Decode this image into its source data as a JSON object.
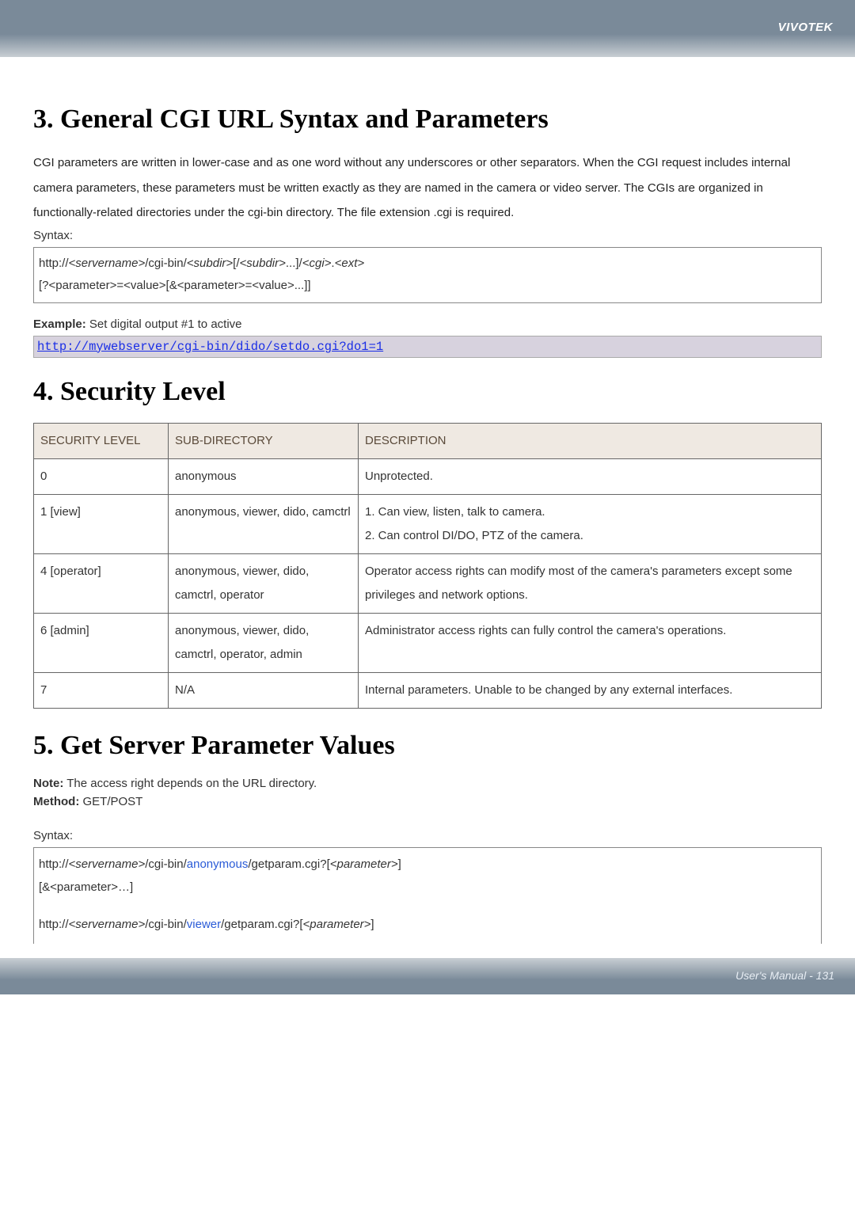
{
  "brand": "VIVOTEK",
  "footer": "User's Manual - 131",
  "section3": {
    "title": "3. General CGI URL Syntax and Parameters",
    "intro": "CGI parameters are written in lower-case and as one word without any underscores or other separators. When the CGI request includes internal camera parameters, these parameters must be written exactly as they are named in the camera or video server. The CGIs are organized in functionally-related directories under the cgi-bin directory. The file extension .cgi is required.",
    "syntax_label": "Syntax:",
    "syntax_prefix": "http://",
    "syntax_servername": "<servername>",
    "syntax_mid1": "/cgi-bin/",
    "syntax_subdir1": "<subdir>",
    "syntax_mid2": "[/",
    "syntax_subdir2": "<subdir>",
    "syntax_mid3": "...]/",
    "syntax_cgi": "<cgi>",
    "syntax_dot": ".",
    "syntax_ext": "<ext>",
    "syntax_line2": "[?<parameter>=<value>[&<parameter>=<value>...]]",
    "example_bold": "Example:",
    "example_rest": " Set digital output #1 to active",
    "example_url": "http://mywebserver/cgi-bin/dido/setdo.cgi?do1=1"
  },
  "section4": {
    "title": "4. Security Level",
    "headers": {
      "level": "SECURITY LEVEL",
      "subdir": "SUB-DIRECTORY",
      "desc": "DESCRIPTION"
    },
    "rows": [
      {
        "level": "0",
        "subdir": "anonymous",
        "desc": "Unprotected."
      },
      {
        "level": "1 [view]",
        "subdir": "anonymous, viewer, dido, camctrl",
        "desc": "1. Can view, listen, talk to camera.\n2. Can control DI/DO, PTZ of the camera."
      },
      {
        "level": "4 [operator]",
        "subdir": "anonymous, viewer, dido, camctrl, operator",
        "desc": "Operator access rights can modify most of the camera's parameters except some privileges and network options."
      },
      {
        "level": "6 [admin]",
        "subdir": "anonymous, viewer, dido, camctrl, operator, admin",
        "desc": "Administrator access rights can fully control the camera's operations."
      },
      {
        "level": "7",
        "subdir": "N/A",
        "desc": "Internal parameters. Unable to be changed by any external interfaces."
      }
    ]
  },
  "section5": {
    "title": "5. Get Server Parameter Values",
    "note_bold": "Note:",
    "note_text": " The access right depends on the URL directory.",
    "method_bold": "Method:",
    "method_text": " GET/POST",
    "syntax_label": "Syntax:",
    "line1_pre": "http://",
    "line1_srv": "<servername>",
    "line1_mid": "/cgi-bin/",
    "line1_blue": "anonymous",
    "line1_post": "/getparam.cgi?[",
    "line1_param": "<parameter>",
    "line1_end": "]",
    "line2": "[&<parameter>…]",
    "line3_pre": "http://",
    "line3_srv": "<servername>",
    "line3_mid": "/cgi-bin/",
    "line3_blue": "viewer",
    "line3_post": "/getparam.cgi?[",
    "line3_param": "<parameter>",
    "line3_end": "]"
  }
}
